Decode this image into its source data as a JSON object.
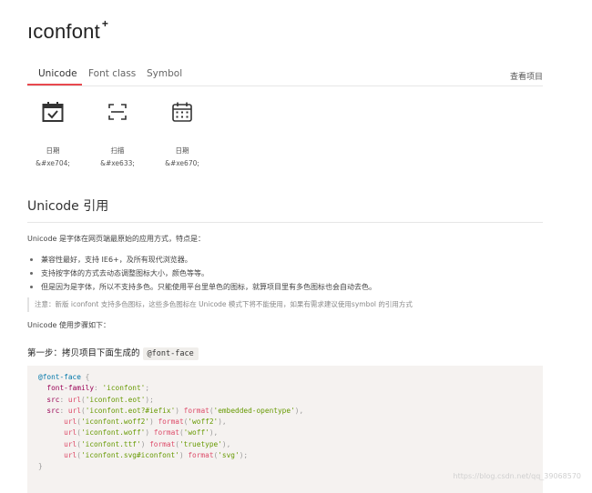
{
  "logo": {
    "text": "ıconfont",
    "mark": "+"
  },
  "tabs": [
    {
      "label": "Unicode",
      "active": true
    },
    {
      "label": "Font class",
      "active": false
    },
    {
      "label": "Symbol",
      "active": false
    }
  ],
  "view_project": "查看项目",
  "icons": [
    {
      "name": "日期",
      "code": "&#xe704;",
      "icon": "calendar-check-icon"
    },
    {
      "name": "扫描",
      "code": "&#xe633;",
      "icon": "scan-icon"
    },
    {
      "name": "日期",
      "code": "&#xe670;",
      "icon": "calendar-grid-icon"
    }
  ],
  "section": {
    "title": "Unicode 引用",
    "intro": "Unicode 是字体在网页端最原始的应用方式，特点是：",
    "bullets": [
      "兼容性最好，支持 IE6+，及所有现代浏览器。",
      "支持按字体的方式去动态调整图标大小，颜色等等。",
      "但是因为是字体，所以不支持多色。只能使用平台里单色的图标，就算项目里有多色图标也会自动去色。"
    ],
    "note": "注意：新版 iconfont 支持多色图标，这些多色图标在 Unicode 模式下将不能使用，如果有需求建议使用symbol 的引用方式",
    "steps_intro": "Unicode 使用步骤如下：",
    "step1_text": "第一步：拷贝项目下面生成的",
    "step1_code": "@font-face"
  },
  "code": {
    "at_rule": "@font-face",
    "brace_open": "{",
    "font_family_prop": "font-family",
    "font_family_value": "'iconfont'",
    "src_prop": "src",
    "url_fn": "url",
    "format_fn": "format",
    "urls": [
      "'iconfont.eot'",
      "'iconfont.eot?#iefix'",
      "'iconfont.woff2'",
      "'iconfont.woff'",
      "'iconfont.ttf'",
      "'iconfont.svg#iconfont'"
    ],
    "formats": [
      "'embedded-opentype'",
      "'woff2'",
      "'woff'",
      "'truetype'",
      "'svg'"
    ],
    "brace_close": "}"
  },
  "watermark": "https://blog.csdn.net/qq_39068570",
  "colors": {
    "accent": "#e8494f",
    "code_bg": "#f5f2f0"
  }
}
